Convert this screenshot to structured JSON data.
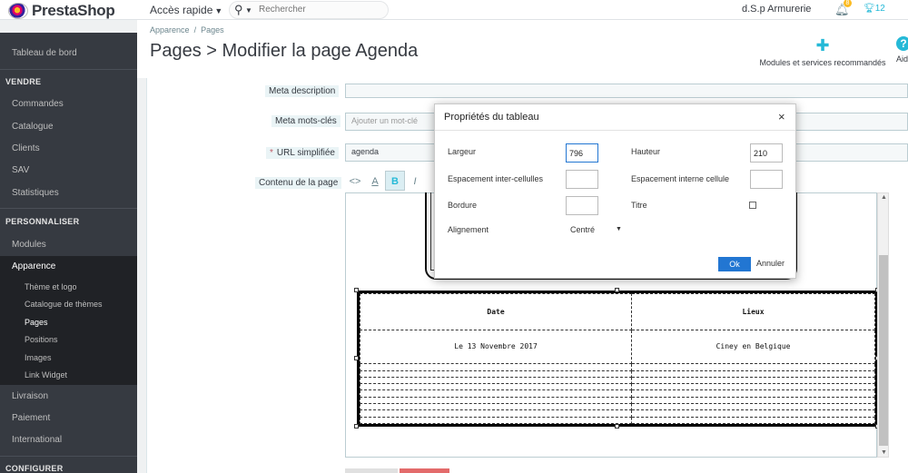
{
  "header": {
    "logo_text": "PrestaShop",
    "quick_access": "Accès rapide",
    "search_placeholder": "Rechercher",
    "shop_name": "d.S.p Armurerie",
    "notifications_count": "8",
    "trophy_count": "12"
  },
  "sidebar": {
    "dashboard": "Tableau de bord",
    "section_sell": "VENDRE",
    "orders": "Commandes",
    "catalog": "Catalogue",
    "customers": "Clients",
    "sav": "SAV",
    "stats": "Statistiques",
    "section_customize": "PERSONNALISER",
    "modules": "Modules",
    "appearance": "Apparence",
    "sub_theme": "Thème et logo",
    "sub_theme_catalog": "Catalogue de thèmes",
    "sub_pages": "Pages",
    "sub_positions": "Positions",
    "sub_images": "Images",
    "sub_link_widget": "Link Widget",
    "shipping": "Livraison",
    "payment": "Paiement",
    "international": "International",
    "section_configure": "CONFIGURER"
  },
  "page": {
    "breadcrumb_parent": "Apparence",
    "breadcrumb_sep": "/",
    "breadcrumb_current": "Pages",
    "title": "Pages > Modifier la page Agenda",
    "toolbar_modules": "Modules et services recommandés",
    "toolbar_help": "Aid"
  },
  "form": {
    "meta_description_label": "Meta description",
    "meta_keywords_label": "Meta mots-clés",
    "meta_keywords_placeholder": "Ajouter un mot-clé",
    "url_label": "URL simplifiée",
    "url_required": "*",
    "url_value": "agenda",
    "content_label": "Contenu de la page"
  },
  "editor_table": {
    "headers": [
      "Date",
      "Lieux"
    ],
    "row1": [
      "Le 13 Novembre 2017",
      "Ciney en Belgique"
    ]
  },
  "dialog": {
    "title": "Propriétés du tableau",
    "close": "×",
    "width_label": "Largeur",
    "width_value": "796",
    "height_label": "Hauteur",
    "height_value": "210",
    "cell_spacing_label": "Espacement inter-cellulles",
    "cell_padding_label": "Espacement interne cellule",
    "border_label": "Bordure",
    "caption_label": "Titre",
    "align_label": "Alignement",
    "align_value": "Centré",
    "ok": "Ok",
    "cancel": "Annuler"
  }
}
